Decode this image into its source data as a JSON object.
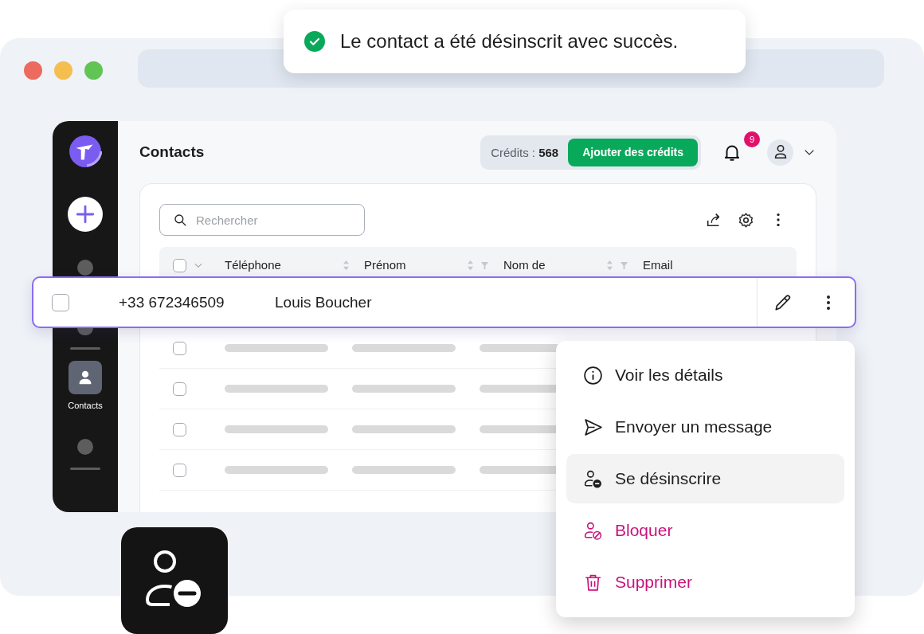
{
  "toast": {
    "text": "Le contact a été désinscrit avec succès."
  },
  "sidebar": {
    "items": [
      {
        "label": "Contacts",
        "selected": true
      }
    ]
  },
  "header": {
    "title": "Contacts",
    "credits_label": "Crédits :",
    "credits_value": "568",
    "add_button": "Ajouter des crédits",
    "notification_count": "9"
  },
  "search": {
    "placeholder": "Rechercher"
  },
  "table": {
    "select_all": {
      "checked": false
    },
    "columns": [
      {
        "label": "Téléphone",
        "sortable": true,
        "filterable": false
      },
      {
        "label": "Prénom",
        "sortable": true,
        "filterable": true
      },
      {
        "label": "Nom de",
        "sortable": true,
        "filterable": true
      },
      {
        "label": "Email",
        "sortable": false,
        "filterable": false
      }
    ],
    "rows": [
      {
        "checked": false
      },
      {
        "checked": false
      },
      {
        "checked": false
      },
      {
        "checked": false
      }
    ]
  },
  "highlighted_row": {
    "checked": false,
    "phone": "+33 672346509",
    "name": "Louis Boucher"
  },
  "menu": {
    "items": [
      {
        "label": "Voir les détails",
        "kind": "normal",
        "selected": false
      },
      {
        "label": "Envoyer un message",
        "kind": "normal",
        "selected": false
      },
      {
        "label": "Se désinscrire",
        "kind": "normal",
        "selected": true
      },
      {
        "label": "Bloquer",
        "kind": "danger",
        "selected": false
      },
      {
        "label": "Supprimer",
        "kind": "danger",
        "selected": false
      }
    ]
  }
}
